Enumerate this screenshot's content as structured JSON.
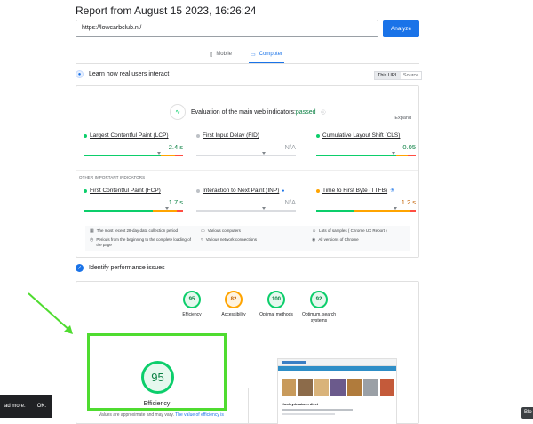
{
  "report": {
    "title": "Report from August 15 2023, 16:26:24",
    "url_value": "https://lowcarbclub.nl/",
    "analyze_label": "Analyze"
  },
  "device_tabs": [
    {
      "label": "Mobile",
      "icon": "mobile-icon",
      "active": false
    },
    {
      "label": "Computer",
      "icon": "desktop-icon",
      "active": true
    }
  ],
  "rum": {
    "heading": "Learn how real users interact",
    "source_toggle": [
      "This URL",
      "Source"
    ],
    "cwv_title": "Evaluation of the main web indicators:",
    "cwv_status": "passed",
    "expand": "Expand",
    "core_metrics": [
      {
        "label": "Largest Contentful Paint (LCP)",
        "value": "2.4 s",
        "status": "good",
        "dist": [
          0.78,
          0.14,
          0.08
        ],
        "marker": 0.74
      },
      {
        "label": "First Input Delay (FID)",
        "value": "N/A",
        "status": "na",
        "dist": [
          1,
          0,
          0
        ],
        "marker": 0.66
      },
      {
        "label": "Cumulative Layout Shift (CLS)",
        "value": "0.05",
        "status": "good",
        "dist": [
          0.8,
          0.12,
          0.08
        ],
        "marker": 0.76
      }
    ],
    "other_heading": "OTHER IMPORTANT INDICATORS",
    "other_metrics": [
      {
        "label": "First Contentful Paint (FCP)",
        "value": "1.7 s",
        "status": "good",
        "dist": [
          0.7,
          0.24,
          0.06
        ],
        "marker": 0.82
      },
      {
        "label": "Interaction to Next Paint (INP)",
        "value": "N/A",
        "status": "na",
        "dist": [
          1,
          0,
          0
        ],
        "marker": 0.66,
        "info_badge": true
      },
      {
        "label": "Time to First Byte (TTFB)",
        "value": "1.2 s",
        "status": "warn",
        "dist": [
          0.38,
          0.56,
          0.06
        ],
        "marker": 0.78,
        "experimental": true
      }
    ],
    "footer": [
      {
        "icon": "calendar-icon",
        "text": "The most recent 28-day data collection period"
      },
      {
        "icon": "devices-icon",
        "text": "Various computers"
      },
      {
        "icon": "people-icon",
        "text": "Lots of samples ( Chrome UX Report )"
      },
      {
        "icon": "timer-icon",
        "text": "Periods from the beginning to the complete loading of the page"
      },
      {
        "icon": "wifi-icon",
        "text": "Various network connections"
      },
      {
        "icon": "chrome-icon",
        "text": "All versions of Chrome"
      }
    ]
  },
  "perf": {
    "heading": "Identify performance issues",
    "gauges": [
      {
        "score": "95",
        "label": "Efficiency",
        "status": "good"
      },
      {
        "score": "82",
        "label": "Accessibility",
        "status": "mid"
      },
      {
        "score": "100",
        "label": "Optimal methods",
        "status": "good"
      },
      {
        "score": "92",
        "label": "Optimum. search systems",
        "status": "good"
      }
    ],
    "big_score": "95",
    "big_label": "Efficiency",
    "note_prefix": "Values are approximate and may vary.",
    "note_link": "The value of efficiency is",
    "thumb_heading": "Koolhydraatarm dieet"
  },
  "banner": {
    "text": "ad more.",
    "ok": "OK."
  },
  "chip": "Blo",
  "colors": {
    "good": "#0cce6b",
    "mid": "#ffa400",
    "poor": "#ff4e42",
    "accent": "#1a73e8",
    "highlight": "#4fdc30"
  }
}
